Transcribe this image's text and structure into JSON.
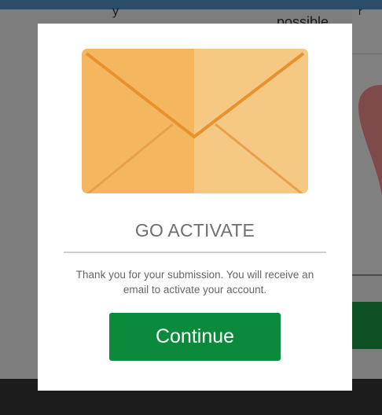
{
  "background": {
    "partial_text": "possible",
    "partial_text_2": "y",
    "partial_text_3": "r"
  },
  "modal": {
    "title": "GO ACTIVATE",
    "message": "Thank you for your submission. You will receive an email to activate your account.",
    "continue_label": "Continue",
    "icon": "envelope-icon"
  },
  "colors": {
    "envelope_left": "#f4b760",
    "envelope_right": "#f5c883",
    "envelope_fold": "#e8922f",
    "button": "#0b8a3c",
    "title": "#6f6f6f",
    "overlay": "#7d7d7d",
    "topbar": "#2b4c67",
    "heart": "#7e4a4a"
  }
}
